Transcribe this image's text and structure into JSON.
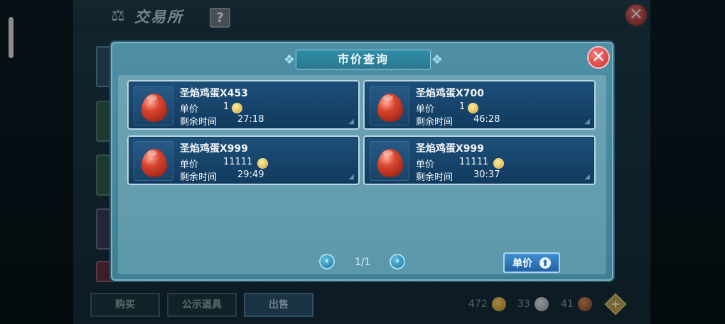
{
  "app": {
    "title": "交易所",
    "help_label": "?",
    "close_label": "✕"
  },
  "modal": {
    "title": "市价查询",
    "close_label": "✕",
    "listings": [
      {
        "name": "圣焰鸡蛋X453",
        "price_label": "单价",
        "price": "1",
        "time_label": "剩余时间",
        "time": "27:18"
      },
      {
        "name": "圣焰鸡蛋X700",
        "price_label": "单价",
        "price": "1",
        "time_label": "剩余时间",
        "time": "46:28"
      },
      {
        "name": "圣焰鸡蛋X999",
        "price_label": "单价",
        "price": "11111",
        "time_label": "剩余时间",
        "time": "29:49"
      },
      {
        "name": "圣焰鸡蛋X999",
        "price_label": "单价",
        "price": "11111",
        "time_label": "剩余时间",
        "time": "30:37"
      }
    ],
    "pager": {
      "prev": "‹",
      "next": "›",
      "indicator": "1/1"
    },
    "sort_button": "单价"
  },
  "bottom": {
    "tabs": [
      "购买",
      "公示道具",
      "出售"
    ],
    "currency": [
      {
        "value": "472",
        "type": "gold-coin-icon"
      },
      {
        "value": "33",
        "type": "silver-coin-icon"
      },
      {
        "value": "41",
        "type": "copper-coin-icon"
      }
    ]
  },
  "icons": {
    "scale": "⚖",
    "swirl": "❖",
    "plus": "+",
    "up": "⬆"
  },
  "colors": {
    "card_bg": "#1c4f79",
    "modal_bg": "#4f8fa6",
    "close_red": "#c92c2c",
    "accent_blue": "#2462a4"
  }
}
